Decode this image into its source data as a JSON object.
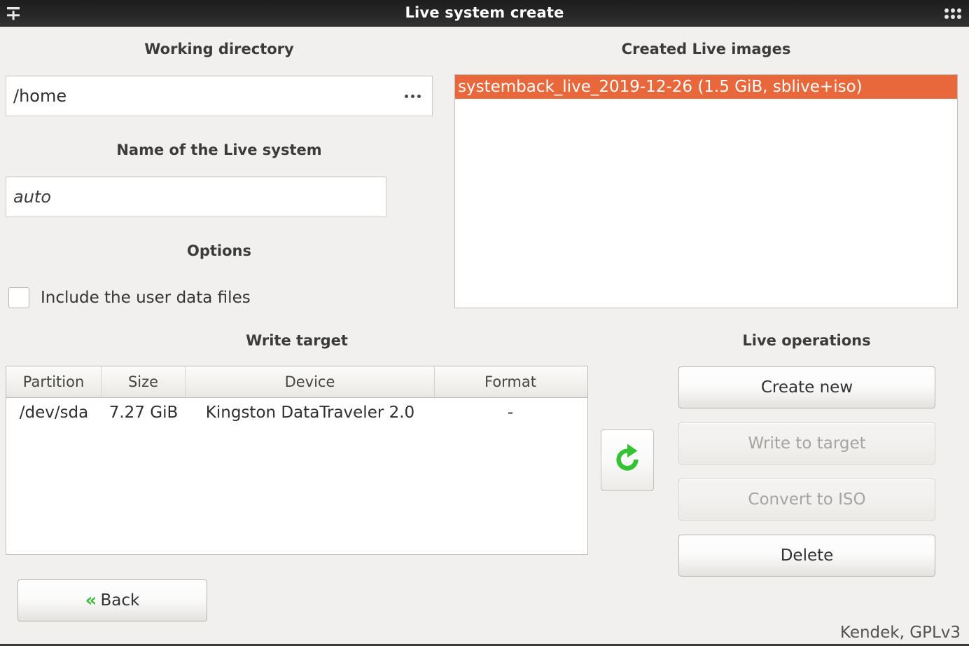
{
  "window": {
    "title": "Live system create",
    "left_icon": "insert-row-icon",
    "right_icon": "grid-dots-menu-icon"
  },
  "working_directory": {
    "label": "Working directory",
    "value": "/home",
    "browse_icon": "ellipsis-browse-icon"
  },
  "live_system_name": {
    "label": "Name of the Live system",
    "value": "auto",
    "is_placeholder": true
  },
  "options": {
    "label": "Options",
    "items": [
      {
        "label": "Include the user data files",
        "checked": false
      }
    ]
  },
  "created_live_images": {
    "label": "Created Live images",
    "items": [
      {
        "label": "systemback_live_2019-12-26 (1.5 GiB, sblive+iso)",
        "selected": true
      }
    ]
  },
  "write_target": {
    "label": "Write target",
    "columns": [
      "Partition",
      "Size",
      "Device",
      "Format"
    ],
    "rows": [
      [
        "/dev/sda",
        "7.27 GiB",
        "Kingston DataTraveler 2.0",
        "-"
      ]
    ]
  },
  "refresh": {
    "icon": "refresh-circular-arrow-icon"
  },
  "live_operations": {
    "label": "Live operations",
    "buttons": [
      {
        "label": "Create new",
        "enabled": true
      },
      {
        "label": "Write to target",
        "enabled": false
      },
      {
        "label": "Convert to ISO",
        "enabled": false
      },
      {
        "label": "Delete",
        "enabled": true
      }
    ]
  },
  "back_button": {
    "label": "Back",
    "chevron": "«"
  },
  "footer": {
    "credit": "Kendek, GPLv3"
  },
  "colors": {
    "selection_orange": "#e8683c",
    "accent_green": "#3fbc3f",
    "window_background": "#f1f0ee",
    "titlebar": "#242424"
  }
}
